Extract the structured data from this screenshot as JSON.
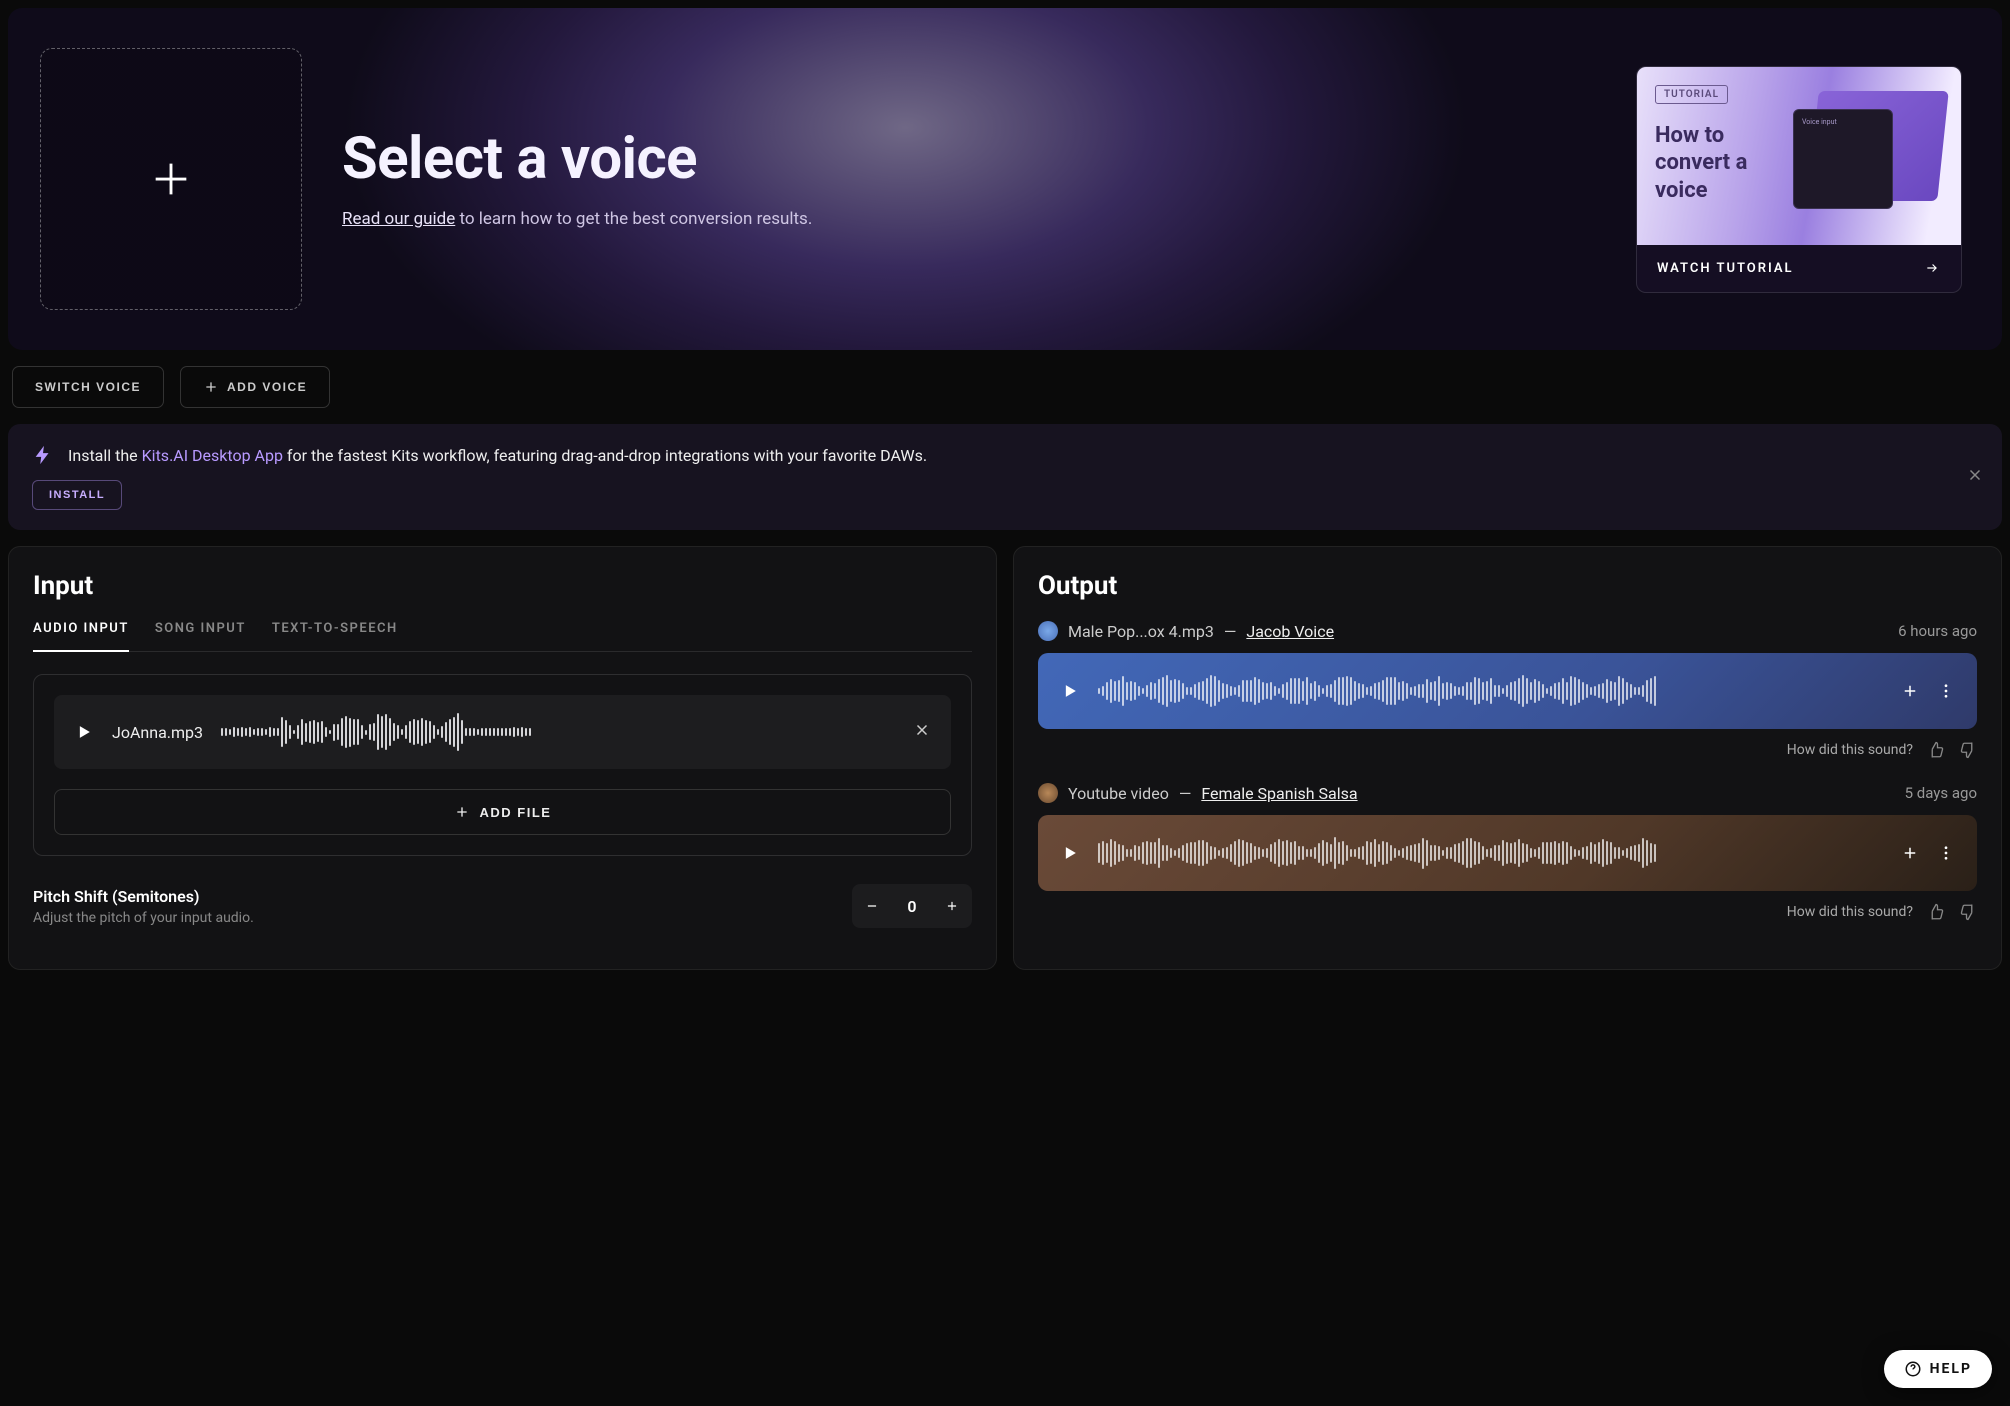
{
  "hero": {
    "title": "Select a voice",
    "guide_link": "Read our guide",
    "subtitle_rest": " to learn how to get the best conversion results."
  },
  "tutorial": {
    "badge": "TUTORIAL",
    "headline": "How to convert a voice",
    "mock_label": "Voice input",
    "watch": "WATCH TUTORIAL"
  },
  "actions": {
    "switch": "SWITCH VOICE",
    "add": "ADD VOICE"
  },
  "banner": {
    "prefix": "Install the ",
    "app": "Kits.AI Desktop App",
    "suffix": " for the fastest Kits workflow, featuring drag-and-drop integrations with your favorite DAWs.",
    "install": "INSTALL"
  },
  "input": {
    "title": "Input",
    "tabs": [
      "AUDIO INPUT",
      "SONG INPUT",
      "TEXT-TO-SPEECH"
    ],
    "filename": "JoAnna.mp3",
    "add_file": "ADD FILE",
    "pitch_label": "Pitch Shift (Semitones)",
    "pitch_desc": "Adjust the pitch of your input audio.",
    "pitch_value": "0"
  },
  "output": {
    "title": "Output",
    "items": [
      {
        "source": "Male Pop...ox 4.mp3",
        "sep": " — ",
        "voice": "Jacob Voice",
        "time": "6 hours ago",
        "theme": "blue"
      },
      {
        "source": "Youtube video",
        "sep": " — ",
        "voice": "Female Spanish Salsa",
        "time": "5 days ago",
        "theme": "brown"
      }
    ],
    "feedback_q": "How did this sound?"
  },
  "help": "HELP"
}
